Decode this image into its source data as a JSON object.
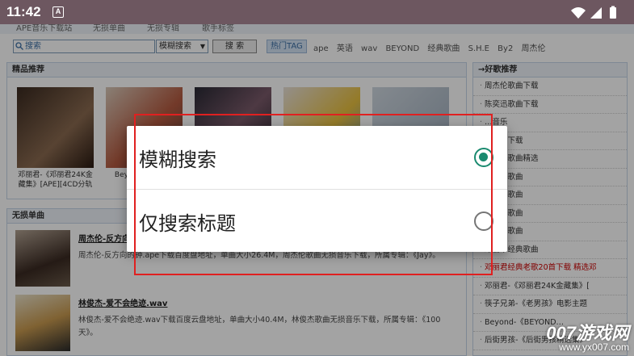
{
  "statusbar": {
    "time": "11:42",
    "notif_badge": "A"
  },
  "nav": {
    "items": [
      "APE音乐下载站",
      "无损单曲",
      "无损专辑",
      "歌手标签"
    ]
  },
  "search": {
    "placeholder": "搜索",
    "mode_value": "模糊搜索",
    "button_label": "搜 索",
    "hot_label": "热门TAG",
    "hot_tags": [
      "ape",
      "英语",
      "wav",
      "BEYOND",
      "经典歌曲",
      "S.H.E",
      "By2",
      "周杰伦"
    ]
  },
  "albums": {
    "heading": "精品推荐",
    "items": [
      {
        "caption": "邓丽君-《邓丽君24K金藏集》[APE][4CD分轨"
      },
      {
        "caption": "Beyond-《…版》[APE]"
      },
      {
        "caption": ""
      },
      {
        "caption": ""
      },
      {
        "caption": ""
      }
    ]
  },
  "songs": {
    "heading": "无损单曲",
    "items": [
      {
        "title": "周杰伦-反方向的",
        "desc": "周杰伦-反方向的钟.ape下载百度盘地址，单曲大小26.4M，周杰伦歌曲无损音乐下载，所属专辑：《Jay》。"
      },
      {
        "title": "林俊杰-爱不会绝迹.wav",
        "desc": "林俊杰-爱不会绝迹.wav下载百度云盘地址，单曲大小40.4M，林俊杰歌曲无损音乐下载，所属专辑：《100天》。"
      }
    ]
  },
  "sidebar": {
    "heading": "→好歌推荐",
    "items": [
      "周杰伦歌曲下载",
      "陈奕迅歌曲下载",
      "…音乐",
      "…歌曲下载",
      "…经典歌曲精选",
      "…经典歌曲",
      "…经典歌曲",
      "…经典歌曲",
      "…经典歌曲",
      "邓丽华经典歌曲",
      "邓丽君经典老歌20首下载 精选邓",
      "邓丽君-《邓丽君24K金藏集》[",
      "筷子兄弟-《老男孩》电影主题",
      "Beyond-《BEYOND…",
      "后街男孩-《后街男孩精选集》"
    ]
  },
  "dialog": {
    "options": [
      {
        "label": "模糊搜索",
        "selected": true
      },
      {
        "label": "仅搜索标题",
        "selected": false
      }
    ]
  },
  "watermark": {
    "big": "007游戏网",
    "small": "www.yx007.com"
  },
  "colors": {
    "accent": "#1a8a6f",
    "status_bar": "#6d5760",
    "annotation": "#e02020"
  }
}
